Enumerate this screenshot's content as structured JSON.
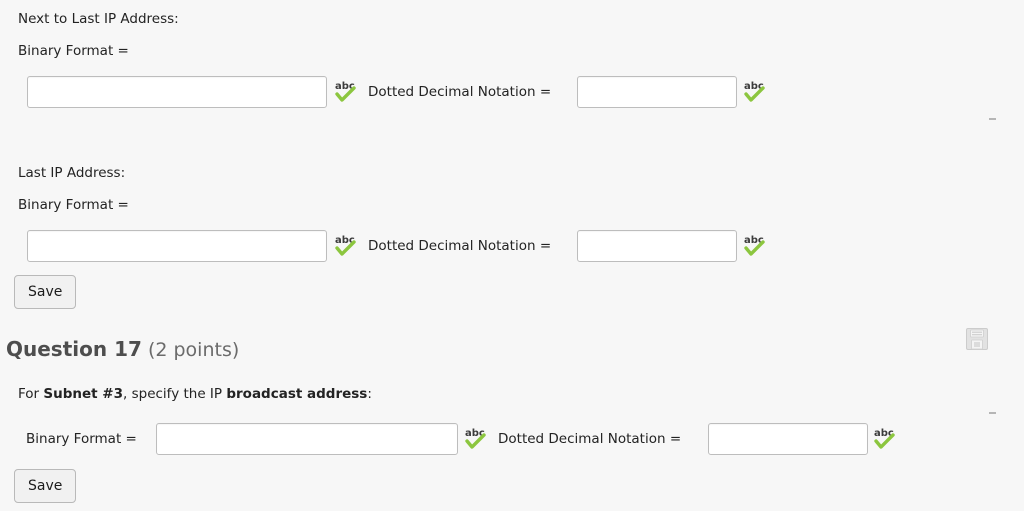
{
  "page": {
    "background_color": "#f7f7f7",
    "text_color": "#232323"
  },
  "sections": [
    {
      "id": "next-to-last-ip",
      "heading": "Next to Last IP Address:",
      "binary_label": "Binary Format =",
      "binary_value": "",
      "binary_placeholder": "",
      "dotted_label": "Dotted Decimal Notation =",
      "dotted_value": "",
      "dotted_placeholder": "",
      "binary_spellcheck_icon": "abc-spellcheck-icon",
      "dotted_spellcheck_icon": "abc-spellcheck-icon"
    },
    {
      "id": "last-ip",
      "heading": "Last IP Address:",
      "binary_label": "Binary Format =",
      "binary_value": "",
      "binary_placeholder": "",
      "dotted_label": "Dotted Decimal Notation =",
      "dotted_value": "",
      "dotted_placeholder": "",
      "binary_spellcheck_icon": "abc-spellcheck-icon",
      "dotted_spellcheck_icon": "abc-spellcheck-icon",
      "save_label": "Save"
    }
  ],
  "question": {
    "title": "Question 17",
    "points": "(2 points)",
    "prompt": {
      "prefix": "For ",
      "subject": "Subnet #3",
      "middle": ", specify the IP ",
      "emphasis": "broadcast address",
      "suffix": ":"
    },
    "save_icon": "floppy-disk-save-icon",
    "binary_label": "Binary Format =",
    "binary_value": "",
    "binary_placeholder": "",
    "dotted_label": "Dotted Decimal Notation =",
    "dotted_value": "",
    "dotted_placeholder": "",
    "binary_spellcheck_icon": "abc-spellcheck-icon",
    "dotted_spellcheck_icon": "abc-spellcheck-icon",
    "save_label": "Save"
  },
  "colors": {
    "spellcheck_text": "#3c3c3c",
    "spellcheck_check": "#8cc63f",
    "input_border": "#bdbdbd",
    "button_face": "#f1f1f1",
    "heading_bold": "#4e4e4e",
    "heading_light": "#6b6b6b",
    "floppy_icon": "#cfcfcf"
  }
}
